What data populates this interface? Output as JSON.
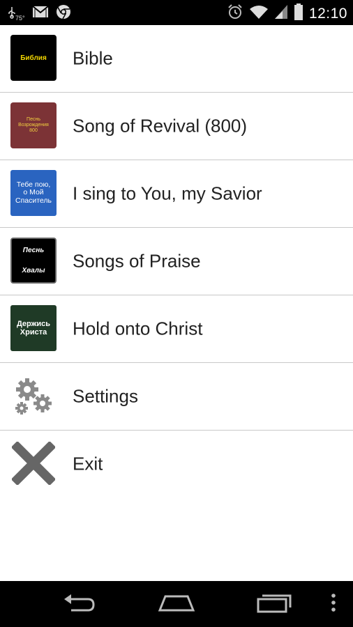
{
  "status_bar": {
    "temperature": "75°",
    "time": "12:10",
    "icons": [
      "usb-icon",
      "gmail-icon",
      "chrome-icon",
      "alarm-icon",
      "wifi-icon",
      "signal-icon",
      "battery-icon"
    ]
  },
  "menu": {
    "items": [
      {
        "label": "Bible",
        "thumb_lines": [
          "Библия"
        ]
      },
      {
        "label": "Song of Revival (800)",
        "thumb_lines": [
          "Песнь",
          "Возрождения",
          "800"
        ]
      },
      {
        "label": "I sing to You, my Savior",
        "thumb_lines": [
          "Тебе пою,",
          "о Мой",
          "Спаситель"
        ]
      },
      {
        "label": "Songs of Praise",
        "thumb_lines": [
          "Песнь",
          "Хвалы"
        ]
      },
      {
        "label": "Hold onto Christ",
        "thumb_lines": [
          "Держись",
          "Христа"
        ]
      },
      {
        "label": "Settings",
        "icon": "gears-icon"
      },
      {
        "label": "Exit",
        "icon": "close-icon"
      }
    ]
  },
  "nav_bar": {
    "icons": [
      "back-icon",
      "home-icon",
      "recent-apps-icon",
      "overflow-menu-icon"
    ]
  },
  "colors": {
    "status_bar_bg": "#000000",
    "divider": "#c8c8c8",
    "text": "#222222"
  }
}
